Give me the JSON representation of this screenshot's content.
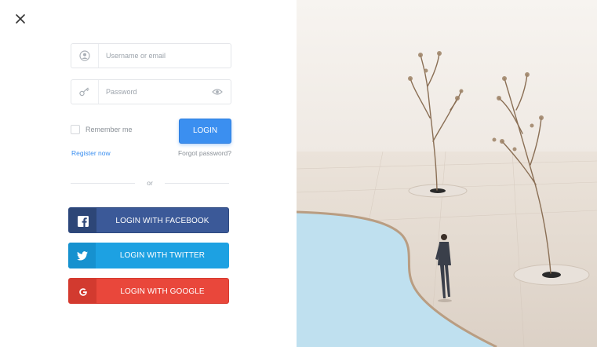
{
  "login_form": {
    "username_placeholder": "Username or email",
    "password_placeholder": "Password",
    "remember_label": "Remember me",
    "login_label": "LOGIN",
    "register_label": "Register now",
    "forgot_label": "Forgot password?",
    "divider_label": "or"
  },
  "social": {
    "facebook_label": "LOGIN WITH FACEBOOK",
    "twitter_label": "LOGIN WITH TWITTER",
    "google_label": "LOGIN WITH GOOGLE"
  },
  "colors": {
    "primary": "#3b8ff0",
    "facebook": "#3b5998",
    "twitter": "#1da1e2",
    "google": "#e9473b",
    "pool": "#bfe0ef"
  },
  "icons": [
    "close-icon",
    "user-icon",
    "key-icon",
    "eye-icon",
    "facebook-icon",
    "twitter-icon",
    "google-icon"
  ]
}
